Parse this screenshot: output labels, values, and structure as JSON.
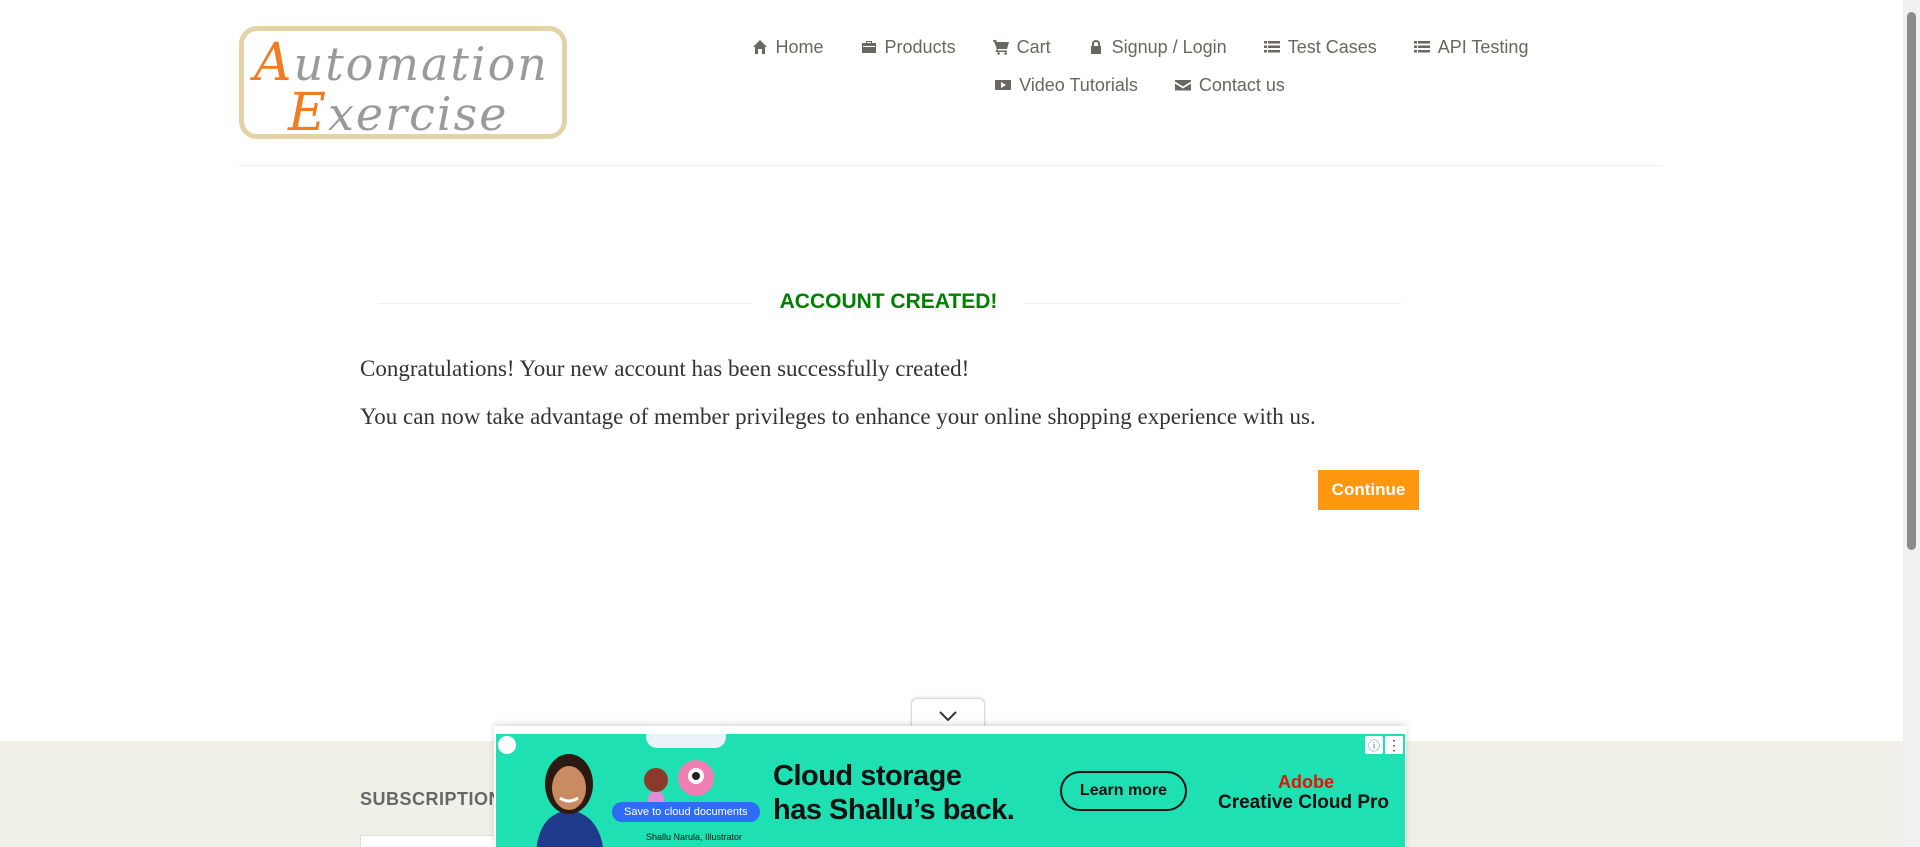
{
  "logo": {
    "line1_cap": "A",
    "line1_rest": "utomation",
    "line2_cap": "E",
    "line2_rest": "xercise"
  },
  "nav": [
    {
      "label": "Home",
      "icon": "home-icon"
    },
    {
      "label": "Products",
      "icon": "products-icon"
    },
    {
      "label": "Cart",
      "icon": "cart-icon"
    },
    {
      "label": "Signup / Login",
      "icon": "lock-icon"
    },
    {
      "label": "Test Cases",
      "icon": "list-icon"
    },
    {
      "label": "API Testing",
      "icon": "list-icon"
    },
    {
      "label": "Video Tutorials",
      "icon": "youtube-icon"
    },
    {
      "label": "Contact us",
      "icon": "envelope-icon"
    }
  ],
  "main": {
    "title": "ACCOUNT CREATED!",
    "message1": "Congratulations! Your new account has been successfully created!",
    "message2": "You can now take advantage of member privileges to enhance your online shopping experience with us.",
    "continue_label": "Continue"
  },
  "footer": {
    "subscription_heading": "SUBSCRIPTION"
  },
  "ad": {
    "chip": "Save to cloud documents",
    "caption": "Shallu Narula, Illustrator",
    "headline1": "Cloud storage",
    "headline2": "has Shallu’s back.",
    "cta": "Learn more",
    "brand1": "Adobe",
    "brand2": "Creative Cloud Pro",
    "accent_color": "#1ee0b3",
    "brand_color": "#eb1000"
  },
  "colors": {
    "accent_orange": "#fe980f",
    "success_green": "#008000",
    "nav_text": "#696763"
  }
}
